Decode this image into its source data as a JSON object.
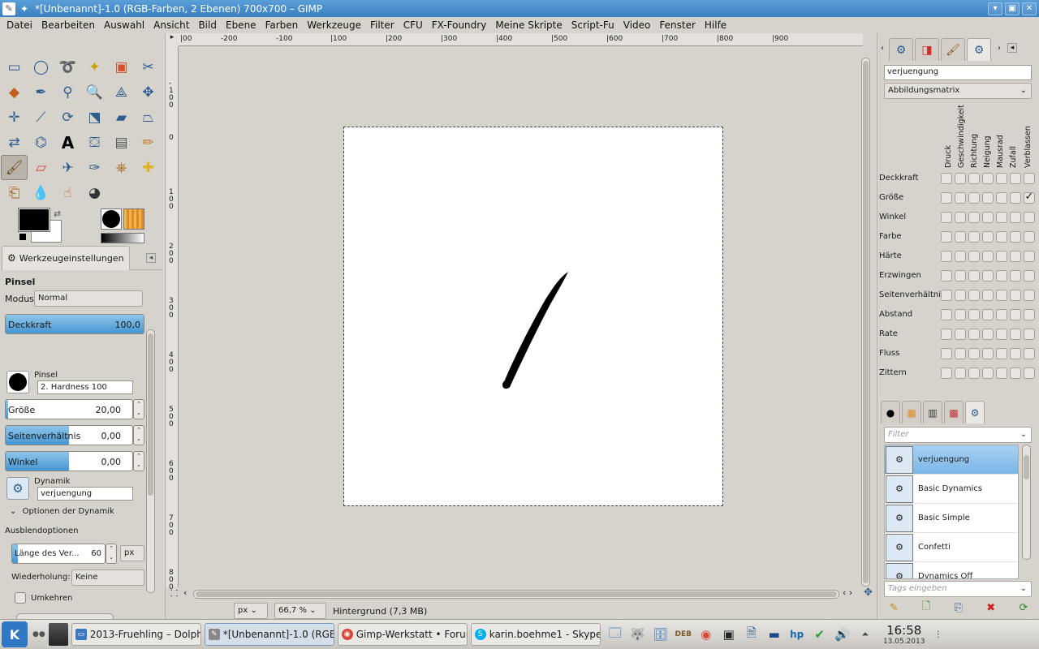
{
  "window": {
    "title": "*[Unbenannt]-1.0 (RGB-Farben, 2 Ebenen) 700x700 – GIMP"
  },
  "menu": [
    "Datei",
    "Bearbeiten",
    "Auswahl",
    "Ansicht",
    "Bild",
    "Ebene",
    "Farben",
    "Werkzeuge",
    "Filter",
    "CFU",
    "FX-Foundry",
    "Meine Skripte",
    "Script-Fu",
    "Video",
    "Fenster",
    "Hilfe"
  ],
  "tool_options": {
    "tab_label": "Werkzeugeinstellungen",
    "tool_name": "Pinsel",
    "mode_label": "Modus:",
    "mode_value": "Normal",
    "opacity_label": "Deckkraft",
    "opacity_value": "100,0",
    "opacity_fraction": 1.0,
    "brush_label": "Pinsel",
    "brush_value": "2. Hardness 100",
    "size_label": "Größe",
    "size_value": "20,00",
    "size_fraction": 0.02,
    "aspect_label": "Seitenverhältnis",
    "aspect_value": "0,00",
    "aspect_fraction": 0.5,
    "angle_label": "Winkel",
    "angle_value": "0,00",
    "angle_fraction": 0.5,
    "dynamics_label": "Dynamik",
    "dynamics_value": "verjuengung",
    "dynamics_options": "Optionen der Dynamik",
    "fade_label": "Ausblendoptionen",
    "fade_length_label": "Länge des Ver...",
    "fade_length_value": "60",
    "fade_length_fraction": 0.06,
    "fade_unit": "px",
    "repeat_label": "Wiederholung:",
    "repeat_value": "Keine",
    "reverse_label": "Umkehren"
  },
  "ruler": {
    "h_ticks": [
      "|00",
      "|100",
      "|200",
      "|300",
      "|400",
      "|500",
      "|600",
      "|700",
      "|800",
      "|900"
    ],
    "h_neg": [
      "-200",
      "-100"
    ],
    "v_ticks": [
      "0",
      "100",
      "200",
      "300",
      "400",
      "500",
      "600",
      "700",
      "800"
    ],
    "v_neg": [
      "-100"
    ]
  },
  "status": {
    "unit": "px",
    "zoom": "66,7 %",
    "layer_info": "Hintergrund (7,3 MB)"
  },
  "dynamics_editor": {
    "name": "verjuengung",
    "mapping": "Abbildungsmatrix",
    "columns": [
      "Druck",
      "Geschwindigkeit",
      "Richtung",
      "Neigung",
      "Mausrad",
      "Zufall",
      "Verblassen"
    ],
    "rows": [
      "Deckkraft",
      "Größe",
      "Winkel",
      "Farbe",
      "Härte",
      "Erzwingen",
      "Seitenverhältnis",
      "Abstand",
      "Rate",
      "Fluss",
      "Zittern"
    ],
    "checked": [
      {
        "row": 1,
        "col": 6
      }
    ]
  },
  "dynamics_list": {
    "filter_placeholder": "Filter",
    "items": [
      "verjuengung",
      "Basic Dynamics",
      "Basic Simple",
      "Confetti",
      "Dynamics Off"
    ],
    "selected": 0,
    "tags_placeholder": "Tags eingeben"
  },
  "taskbar": {
    "tasks": [
      {
        "label": "2013-Fruehling – Dolphin",
        "color": "#3a78c2"
      },
      {
        "label": "*[Unbenannt]-1.0 (RGB-...",
        "color": "#888888"
      },
      {
        "label": "Gimp-Werkstatt • Forum",
        "color": "#db4437"
      },
      {
        "label": "karin.boehme1 - Skype™",
        "color": "#00aff0"
      }
    ],
    "time": "16:58",
    "date": "13.05.2013"
  }
}
